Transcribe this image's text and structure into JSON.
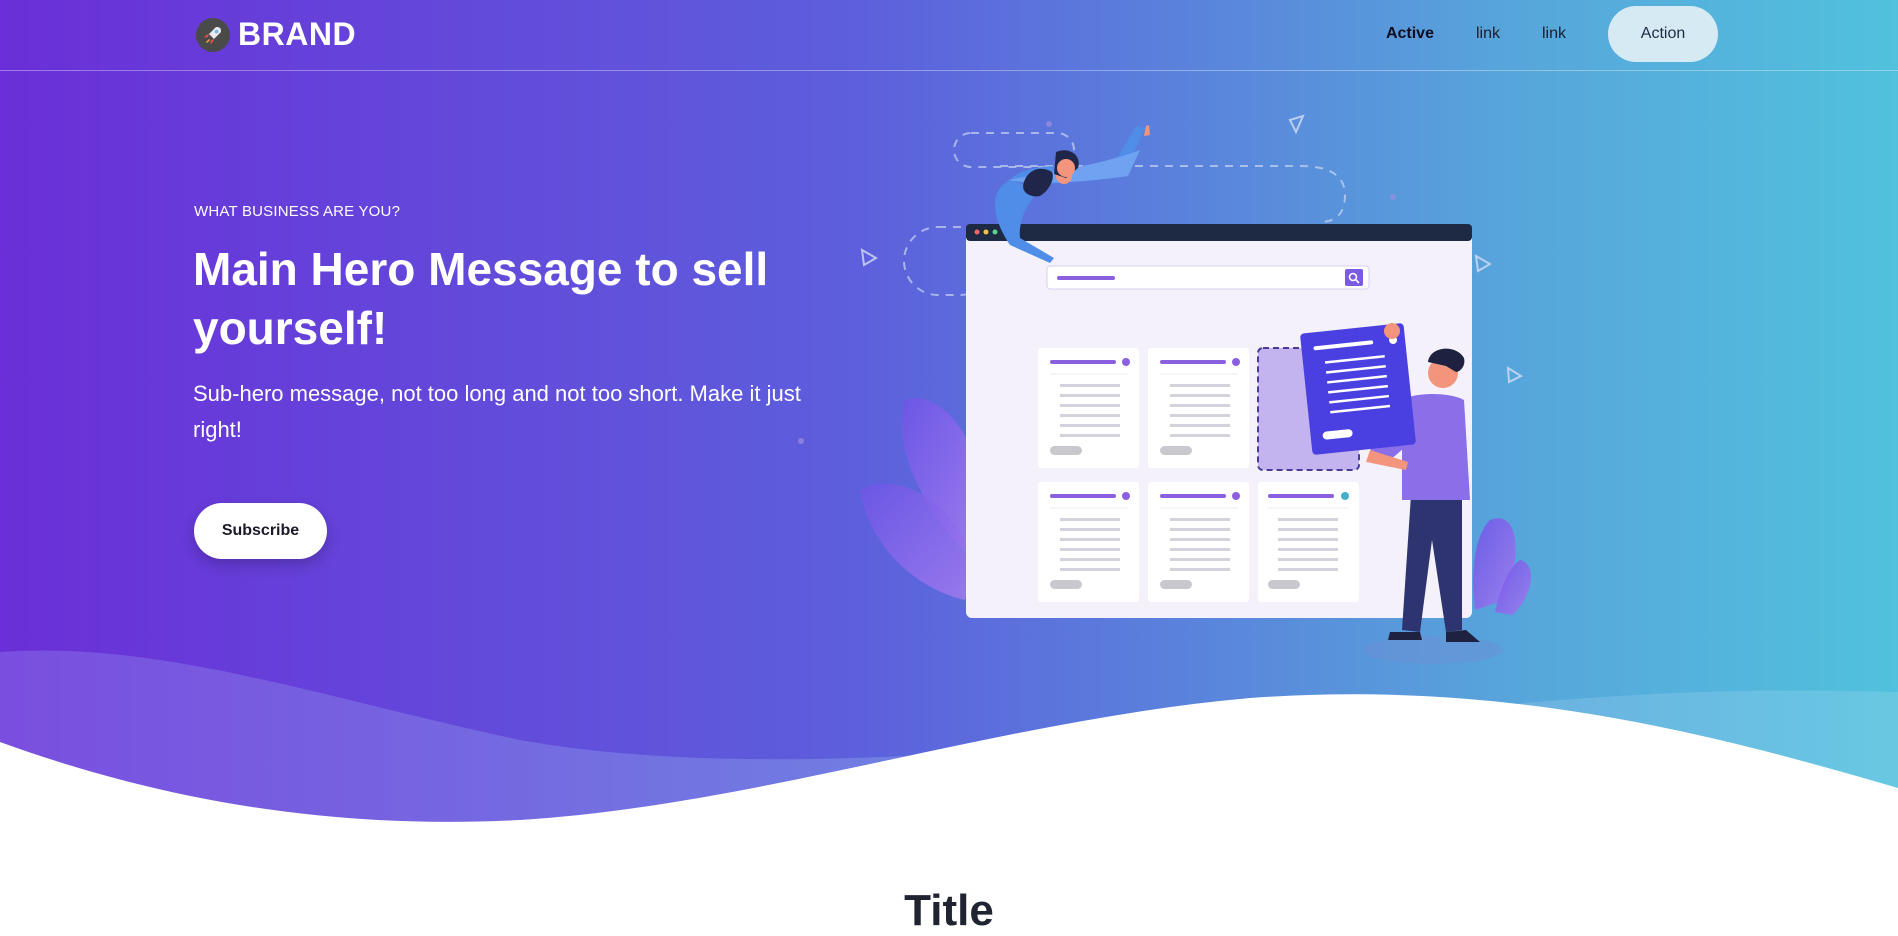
{
  "nav": {
    "brand": "BRAND",
    "links": [
      "Active",
      "link",
      "link"
    ],
    "action_label": "Action"
  },
  "hero": {
    "kicker": "WHAT BUSINESS ARE YOU?",
    "headline": "Main Hero Message to sell yourself!",
    "subheadline": "Sub-hero message, not too long and not too short. Make it just right!",
    "cta_label": "Subscribe"
  },
  "section": {
    "title": "Title"
  },
  "colors": {
    "gradient_start": "#6a2fd8",
    "gradient_end": "#51c1dd",
    "accent_purple": "#6c4ee8",
    "action_bg": "#d6eaf3"
  },
  "icons": [
    "rocket-icon",
    "search-icon"
  ]
}
